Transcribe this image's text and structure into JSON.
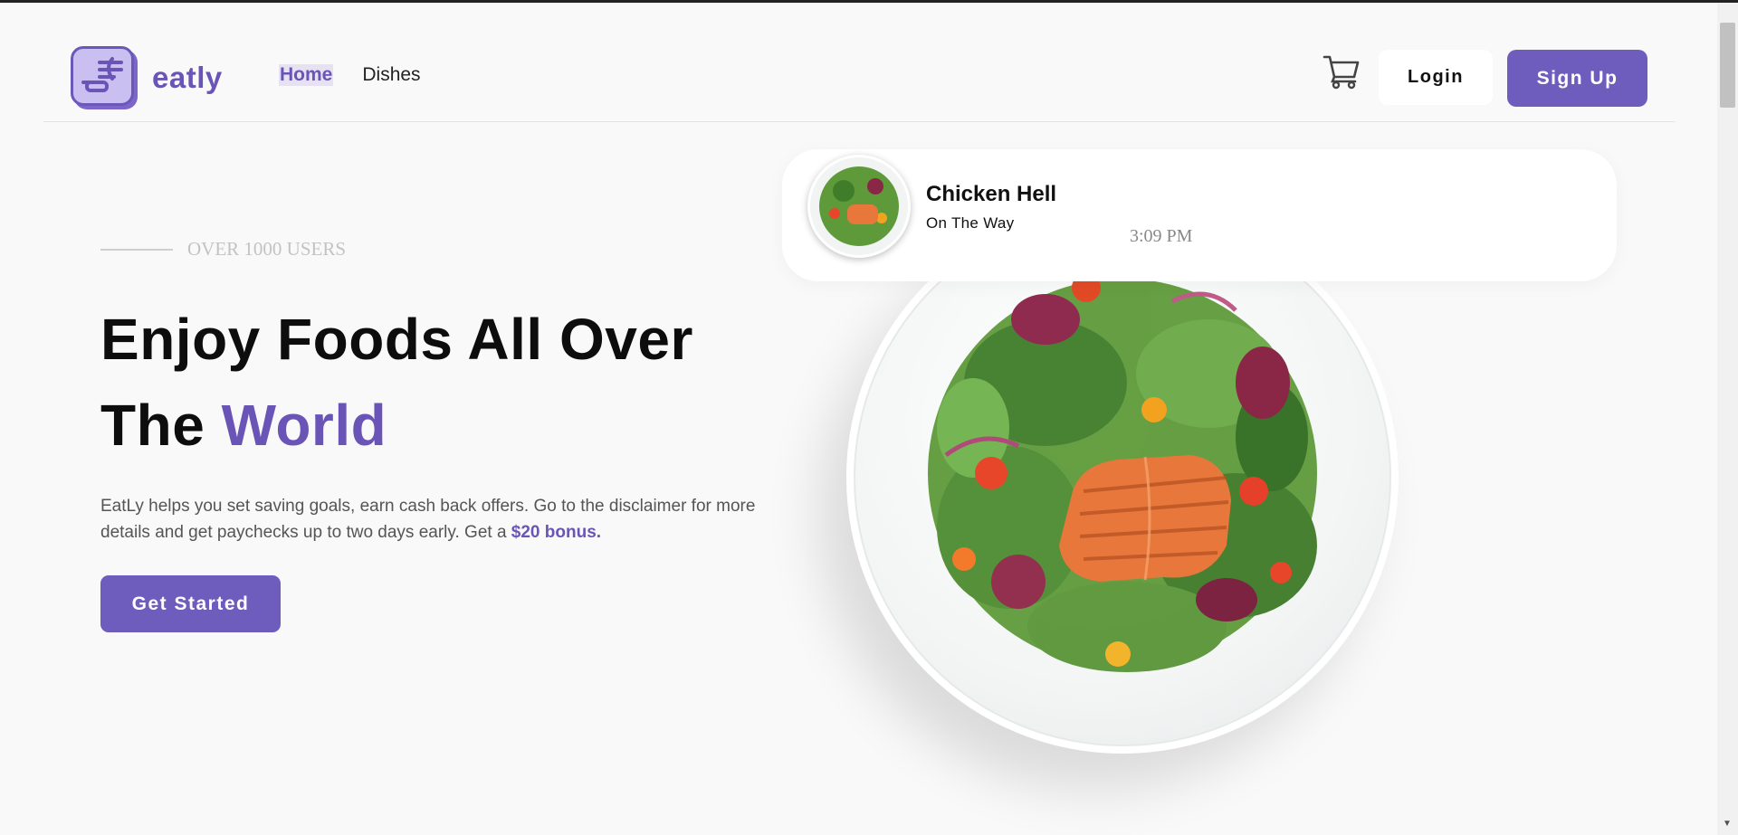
{
  "brand": {
    "name": "eatly",
    "accent_color": "#6e5dbd"
  },
  "nav": {
    "links": [
      {
        "label": "Home",
        "active": true
      },
      {
        "label": "Dishes",
        "active": false
      }
    ],
    "cart_icon": "cart-icon",
    "login_label": "Login",
    "signup_label": "Sign Up"
  },
  "hero": {
    "eyebrow": "OVER 1000 USERS",
    "headline_line1": "Enjoy Foods All Over",
    "headline_line2_prefix": "The ",
    "headline_accent": "World",
    "description": "EatLy helps you set saving goals, earn cash back offers. Go to the disclaimer for more details and get paychecks up to two days early. Get a ",
    "description_bonus": "$20 bonus.",
    "cta_label": "Get Started"
  },
  "order_card": {
    "title": "Chicken Hell",
    "status": "On The Way",
    "time": "3:09 PM"
  }
}
